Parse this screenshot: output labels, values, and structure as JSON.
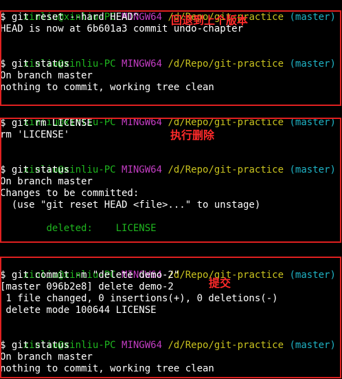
{
  "prompt": {
    "user_host": "xinliu@xinliu-PC",
    "env": "MINGW64",
    "path": "/d/Repo/git-practice",
    "branch": "(master)"
  },
  "colors": {
    "user_host": "#1fb81f",
    "env": "#c33dc3",
    "path": "#c9c31f",
    "branch": "#1fb3c5",
    "text": "#ffffff",
    "deleted": "#1fb81f",
    "annotation": "#ff2a2a",
    "box_border": "#e02020"
  },
  "block1": {
    "cmd1": "$ git reset --hard HEAD^",
    "out1": "HEAD is now at 6b601a3 commit undo-chapter",
    "cmd2": "$ git status",
    "out2": "On branch master",
    "out3": "nothing to commit, working tree clean",
    "annotation": "回退到上个版本"
  },
  "block2": {
    "cmd1": "$ git rm LICENSE",
    "out1": "rm 'LICENSE'",
    "cmd2": "$ git status",
    "out2": "On branch master",
    "out3": "Changes to be committed:",
    "out4": "  (use \"git reset HEAD <file>...\" to unstage)",
    "deleted_label": "deleted:",
    "deleted_file": "LICENSE",
    "annotation": "执行删除"
  },
  "block3": {
    "cmd1": "$ git commit -m \"delete demo-2\"",
    "out1": "[master 096b2e8] delete demo-2",
    "out2": " 1 file changed, 0 insertions(+), 0 deletions(-)",
    "out3": " delete mode 100644 LICENSE",
    "cmd2": "$ git status",
    "out4": "On branch master",
    "out5": "nothing to commit, working tree clean",
    "annotation": "提交"
  }
}
